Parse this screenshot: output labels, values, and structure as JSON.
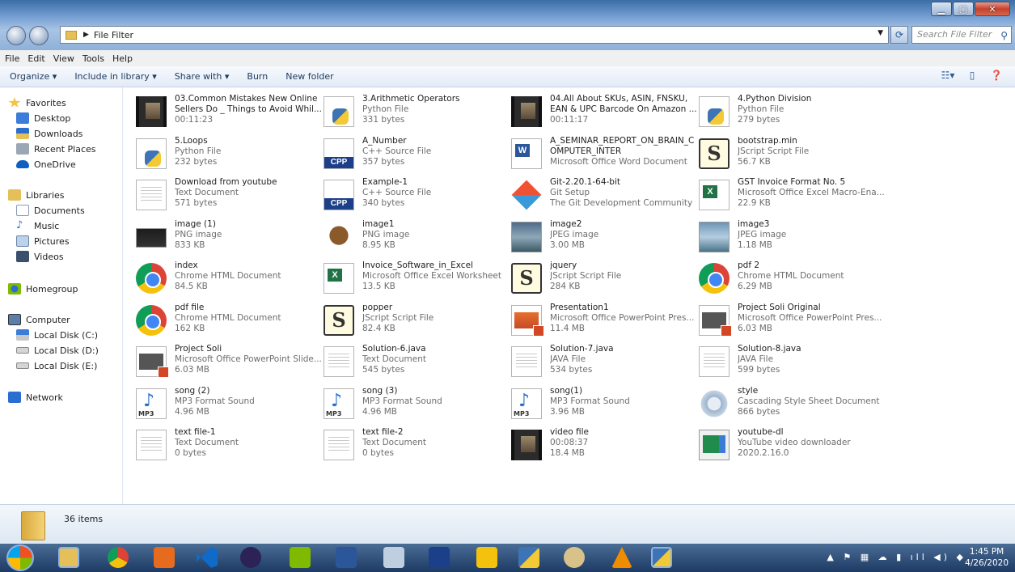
{
  "window": {
    "title_path": "File Filter",
    "search_placeholder": "Search File Filter"
  },
  "menu": [
    "File",
    "Edit",
    "View",
    "Tools",
    "Help"
  ],
  "toolbar": {
    "organize": "Organize ▾",
    "include": "Include in library ▾",
    "share": "Share with ▾",
    "burn": "Burn",
    "new_folder": "New folder"
  },
  "nav": {
    "favorites": "Favorites",
    "desktop": "Desktop",
    "downloads": "Downloads",
    "recent": "Recent Places",
    "onedrive": "OneDrive",
    "libraries": "Libraries",
    "documents": "Documents",
    "music": "Music",
    "pictures": "Pictures",
    "videos": "Videos",
    "homegroup": "Homegroup",
    "computer": "Computer",
    "disk_c": "Local Disk (C:)",
    "disk_d": "Local Disk (D:)",
    "disk_e": "Local Disk (E:)",
    "network": "Network"
  },
  "files": [
    {
      "name": "03.Common Mistakes New Online Sellers Do _ Things to Avoid Whil...",
      "line1": "00:11:23",
      "line2": "",
      "icon": "video-thumbnail-icon"
    },
    {
      "name": "3.Arithmetic Operators",
      "line1": "Python File",
      "line2": "331 bytes",
      "icon": "python-file-icon"
    },
    {
      "name": "04.All About SKUs, ASIN, FNSKU, EAN & UPC Barcode On Amazon ...",
      "line1": "00:11:17",
      "line2": "",
      "icon": "video-thumbnail-icon"
    },
    {
      "name": "4.Python Division",
      "line1": "Python File",
      "line2": "279 bytes",
      "icon": "python-file-icon"
    },
    {
      "name": "5.Loops",
      "line1": "Python File",
      "line2": "232 bytes",
      "icon": "python-file-icon"
    },
    {
      "name": "A_Number",
      "line1": "C++ Source File",
      "line2": "357 bytes",
      "icon": "cpp-file-icon"
    },
    {
      "name": "A_SEMINAR_REPORT_ON_BRAIN_C OMPUTER_INTER",
      "line1": "Microsoft Office Word Document",
      "line2": "",
      "icon": "word-document-icon"
    },
    {
      "name": "bootstrap.min",
      "line1": "JScript Script File",
      "line2": "56.7 KB",
      "icon": "jscript-file-icon"
    },
    {
      "name": "Download from youtube",
      "line1": "Text Document",
      "line2": "571 bytes",
      "icon": "text-document-icon"
    },
    {
      "name": "Example-1",
      "line1": "C++ Source File",
      "line2": "340 bytes",
      "icon": "cpp-file-icon"
    },
    {
      "name": "Git-2.20.1-64-bit",
      "line1": "Git Setup",
      "line2": "The Git Development Community",
      "icon": "git-setup-icon"
    },
    {
      "name": "GST Invoice Format No. 5",
      "line1": "Microsoft Office Excel Macro-Ena...",
      "line2": "22.9 KB",
      "icon": "excel-macro-icon"
    },
    {
      "name": "image (1)",
      "line1": "PNG image",
      "line2": "833 KB",
      "icon": "png-image-icon"
    },
    {
      "name": "image1",
      "line1": "PNG image",
      "line2": "8.95 KB",
      "icon": "owl-image-icon"
    },
    {
      "name": "image2",
      "line1": "JPEG image",
      "line2": "3.00 MB",
      "icon": "jpeg-image-icon"
    },
    {
      "name": "image3",
      "line1": "JPEG image",
      "line2": "1.18 MB",
      "icon": "jpeg-image-icon"
    },
    {
      "name": "index",
      "line1": "Chrome HTML Document",
      "line2": "84.5 KB",
      "icon": "chrome-html-icon"
    },
    {
      "name": "Invoice_Software_in_Excel",
      "line1": "Microsoft Office Excel Worksheet",
      "line2": "13.5 KB",
      "icon": "excel-worksheet-icon"
    },
    {
      "name": "jquery",
      "line1": "JScript Script File",
      "line2": "284 KB",
      "icon": "jscript-file-icon"
    },
    {
      "name": "pdf 2",
      "line1": "Chrome HTML Document",
      "line2": "6.29 MB",
      "icon": "chrome-html-icon"
    },
    {
      "name": "pdf file",
      "line1": "Chrome HTML Document",
      "line2": "162 KB",
      "icon": "chrome-html-icon"
    },
    {
      "name": "popper",
      "line1": "JScript Script File",
      "line2": "82.4 KB",
      "icon": "jscript-file-icon"
    },
    {
      "name": "Presentation1",
      "line1": "Microsoft Office PowerPoint Pres...",
      "line2": "11.4 MB",
      "icon": "powerpoint-presentation-icon"
    },
    {
      "name": "Project Soli Original",
      "line1": "Microsoft Office PowerPoint Pres...",
      "line2": "6.03 MB",
      "icon": "powerpoint-presentation-icon"
    },
    {
      "name": "Project Soli",
      "line1": "Microsoft Office PowerPoint Slide...",
      "line2": "6.03 MB",
      "icon": "powerpoint-slide-icon"
    },
    {
      "name": "Solution-6.java",
      "line1": "Text Document",
      "line2": "545 bytes",
      "icon": "text-document-icon"
    },
    {
      "name": "Solution-7.java",
      "line1": "JAVA File",
      "line2": "534 bytes",
      "icon": "java-file-icon"
    },
    {
      "name": "Solution-8.java",
      "line1": "JAVA File",
      "line2": "599 bytes",
      "icon": "java-file-icon"
    },
    {
      "name": "song (2)",
      "line1": "MP3 Format Sound",
      "line2": "4.96 MB",
      "icon": "mp3-sound-icon"
    },
    {
      "name": "song (3)",
      "line1": "MP3 Format Sound",
      "line2": "4.96 MB",
      "icon": "mp3-sound-icon"
    },
    {
      "name": "song(1)",
      "line1": "MP3 Format Sound",
      "line2": "3.96 MB",
      "icon": "mp3-sound-icon"
    },
    {
      "name": "style",
      "line1": "Cascading Style Sheet Document",
      "line2": "866 bytes",
      "icon": "css-document-icon"
    },
    {
      "name": "text file-1",
      "line1": "Text Document",
      "line2": "0 bytes",
      "icon": "text-document-icon"
    },
    {
      "name": "text file-2",
      "line1": "Text Document",
      "line2": "0 bytes",
      "icon": "text-document-icon"
    },
    {
      "name": "video file",
      "line1": "00:08:37",
      "line2": "18.4 MB",
      "icon": "video-thumbnail-icon"
    },
    {
      "name": "youtube-dl",
      "line1": "YouTube video downloader",
      "line2": "2020.2.16.0",
      "icon": "youtube-dl-icon"
    }
  ],
  "status": {
    "item_count": "36 items"
  },
  "taskbar": {
    "time": "1:45 PM",
    "date": "4/26/2020"
  }
}
